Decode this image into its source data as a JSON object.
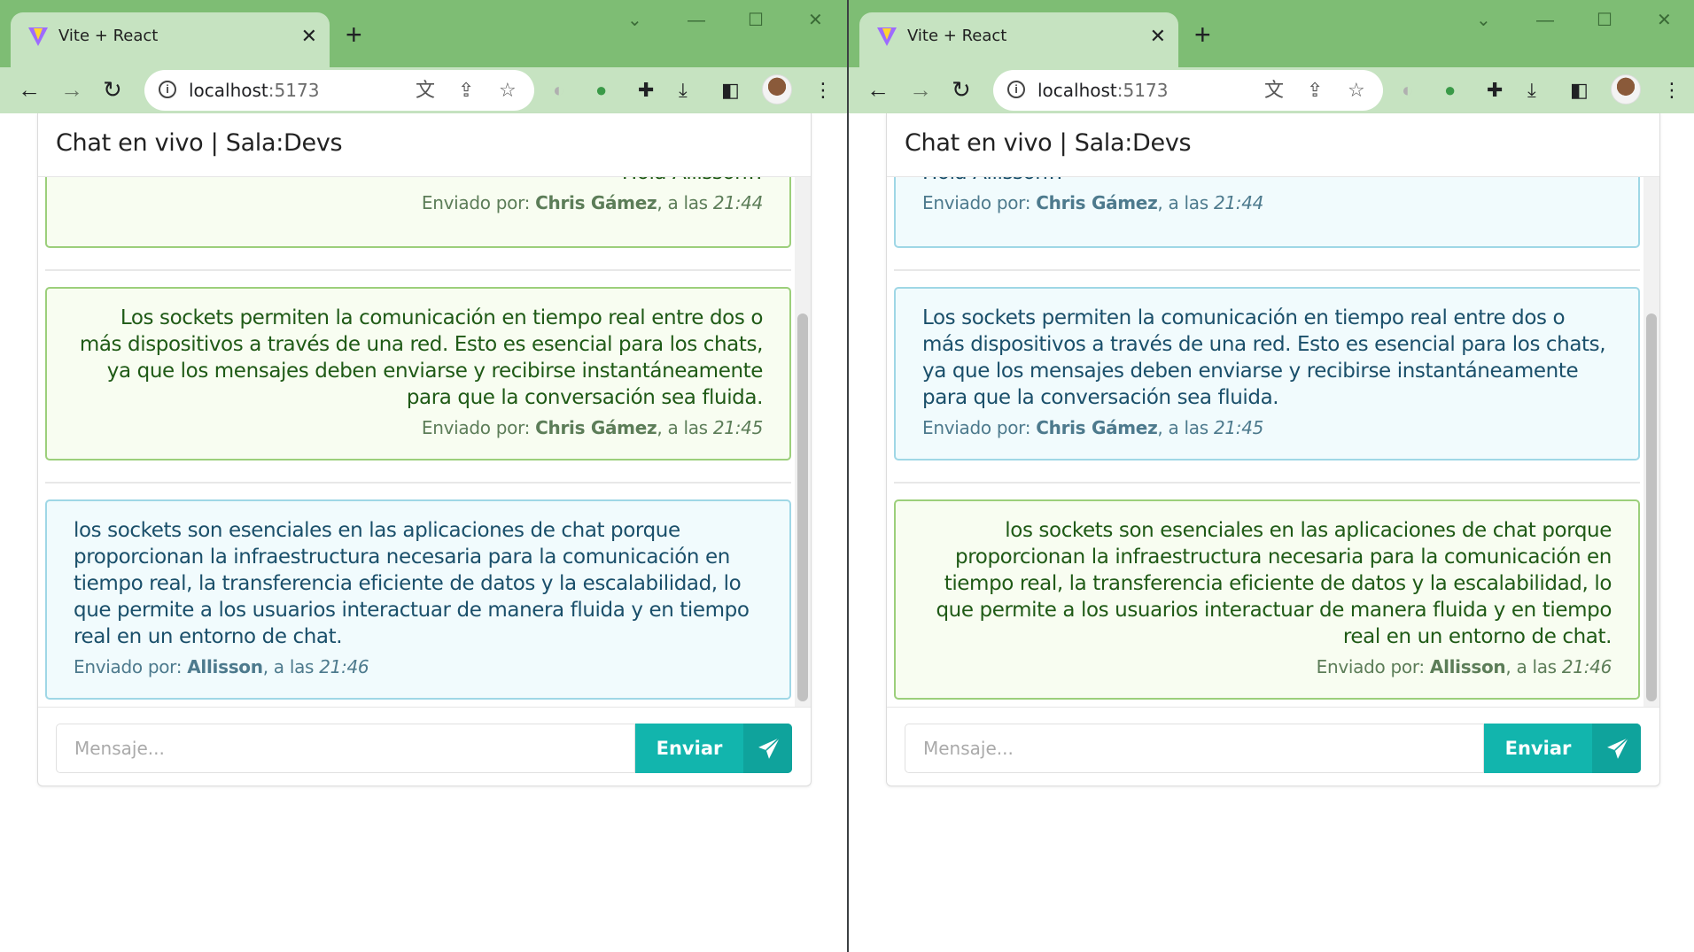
{
  "browser": {
    "tab_title": "Vite + React",
    "url_host": "localhost",
    "url_port": ":5173",
    "icons": [
      "vite-favicon",
      "close-icon",
      "plus-icon",
      "back-arrow",
      "forward-arrow",
      "reload-icon",
      "info-icon",
      "translate-icon",
      "share-icon",
      "star-icon",
      "extension-icon",
      "puzzle-icon",
      "download-icon",
      "sidepanel-icon",
      "avatar",
      "kebab-menu-icon"
    ]
  },
  "chat": {
    "title": "Chat en vivo | Sala:Devs",
    "sent_by_label": "Enviado por: ",
    "at_label": ", a las ",
    "partial_message": "Hola Allisson!!",
    "input_placeholder": "Mensaje...",
    "send_label": "Enviar",
    "messages": [
      {
        "sender": "Chris Gámez",
        "time": "21:44",
        "text": "Hola Allisson!!"
      },
      {
        "sender": "Chris Gámez",
        "time": "21:45",
        "text": "Los sockets permiten la comunicación en tiempo real entre dos o más dispositivos a través de una red. Esto es esencial para los chats, ya que los mensajes deben enviarse y recibirse instantáneamente para que la conversación sea fluida."
      },
      {
        "sender": "Allisson",
        "time": "21:46",
        "text": "los sockets son esenciales en las aplicaciones de chat porque proporcionan la infraestructura necesaria para la comunicación en tiempo real, la transferencia eficiente de datos y la escalabilidad, lo que permite a los usuarios interactuar de manera fluida y en tiempo real en un entorno de chat."
      }
    ]
  },
  "colors": {
    "tabstrip": "#7ebd74",
    "toolbar": "#c6e3c1",
    "mine_bg": "#f8fdf1",
    "mine_border": "#9ccf7b",
    "other_bg": "#f1fbfd",
    "other_border": "#9fd7e6",
    "send_button": "#12b5ad"
  }
}
